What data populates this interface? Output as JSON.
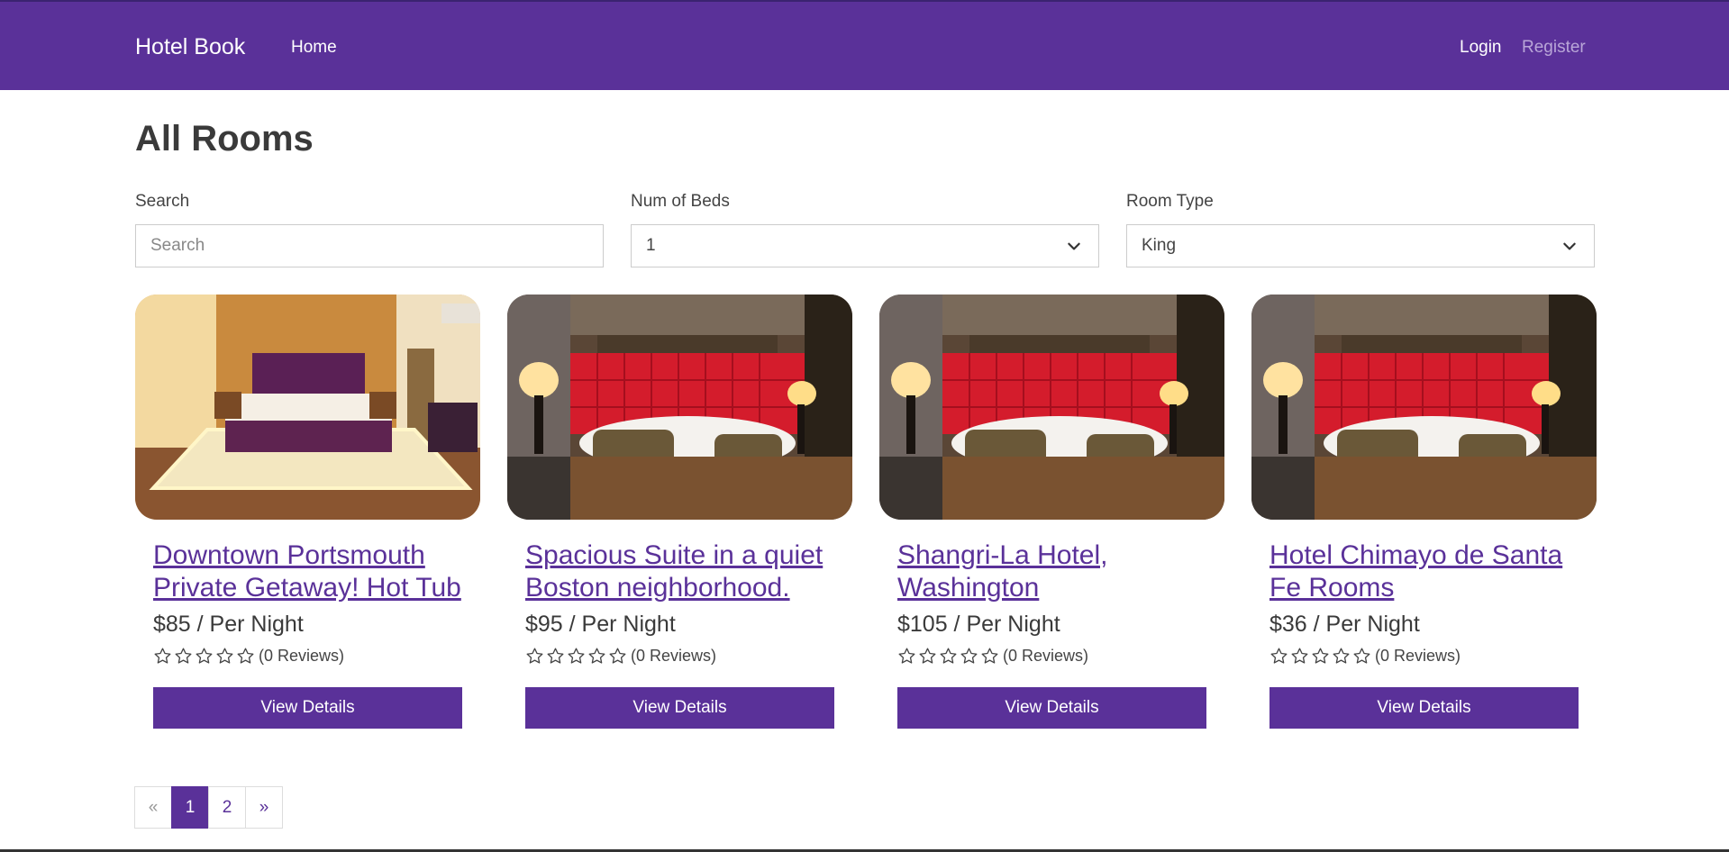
{
  "nav": {
    "brand": "Hotel Book",
    "home": "Home",
    "login": "Login",
    "register": "Register"
  },
  "page_title": "All Rooms",
  "filters": {
    "search": {
      "label": "Search",
      "placeholder": "Search",
      "value": ""
    },
    "beds": {
      "label": "Num of Beds",
      "value": "1"
    },
    "room_type": {
      "label": "Room Type",
      "value": "King"
    }
  },
  "rooms": [
    {
      "title": "Downtown Portsmouth Private Getaway! Hot Tub",
      "price": "$85 / Per Night",
      "reviews": "(0 Reviews)",
      "rating": 0,
      "button": "View Details",
      "image": "hotel-room-photo-warm"
    },
    {
      "title": "Spacious Suite in a quiet Boston neighborhood.",
      "price": "$95 / Per Night",
      "reviews": "(0 Reviews)",
      "rating": 0,
      "button": "View Details",
      "image": "hotel-room-photo-red-headboard"
    },
    {
      "title": "Shangri-La Hotel, Washington",
      "price": "$105 / Per Night",
      "reviews": "(0 Reviews)",
      "rating": 0,
      "button": "View Details",
      "image": "hotel-room-photo-red-headboard"
    },
    {
      "title": "Hotel Chimayo de Santa Fe Rooms",
      "price": "$36 / Per Night",
      "reviews": "(0 Reviews)",
      "rating": 0,
      "button": "View Details",
      "image": "hotel-room-photo-red-headboard"
    }
  ],
  "pagination": {
    "prev": "«",
    "pages": [
      "1",
      "2"
    ],
    "active": "1",
    "next": "»"
  },
  "colors": {
    "brand": "#5a3199",
    "register_muted": "#b9a6d8"
  }
}
